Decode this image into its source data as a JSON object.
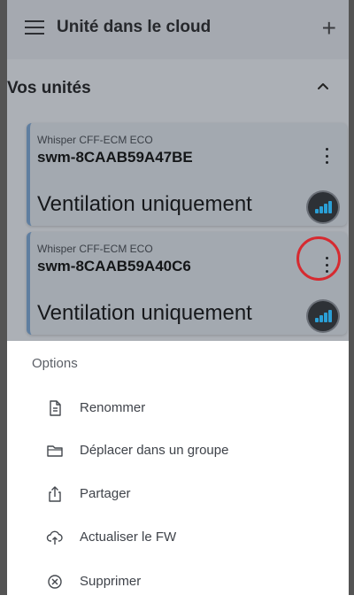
{
  "header": {
    "title": "Unité dans le cloud",
    "add_icon": "plus-icon",
    "menu_icon": "hamburger-menu-icon"
  },
  "section": {
    "title": "Vos unités",
    "toggle_icon": "chevron-up-icon"
  },
  "devices": [
    {
      "model": "Whisper CFF-ECM ECO",
      "id": "swm-8CAAB59A47BE",
      "mode": "Ventilation uniquement",
      "menu_icon": "more-vertical-icon",
      "status_icon": "signal-strength-icon"
    },
    {
      "model": "Whisper CFF-ECM ECO",
      "id": "swm-8CAAB59A40C6",
      "mode": "Ventilation uniquement",
      "menu_icon": "more-vertical-icon",
      "status_icon": "signal-strength-icon",
      "highlighted": true
    }
  ],
  "colors": {
    "highlight": "#d62a30",
    "signal_bar": "#2a9fd6",
    "card_accent": "#5f7ea0"
  },
  "options_sheet": {
    "title": "Options",
    "items": [
      {
        "label": "Renommer",
        "icon": "document-icon"
      },
      {
        "label": "Déplacer dans un groupe",
        "icon": "folder-icon"
      },
      {
        "label": "Partager",
        "icon": "share-icon"
      },
      {
        "label": "Actualiser le FW",
        "icon": "cloud-upload-icon"
      },
      {
        "label": "Supprimer",
        "icon": "close-circle-icon"
      }
    ]
  }
}
